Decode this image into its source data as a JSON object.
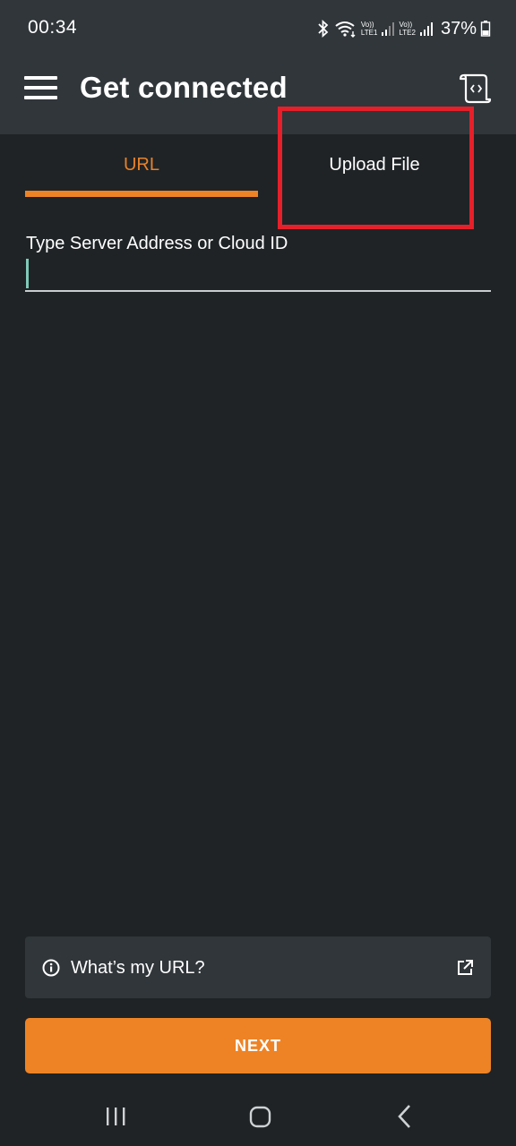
{
  "status_bar": {
    "time": "00:34",
    "sim1_label": "LTE1",
    "sim2_label": "LTE2",
    "volte_label": "Vo))",
    "battery": "37%"
  },
  "app_bar": {
    "title": "Get connected",
    "menu_icon": "hamburger-menu-icon",
    "right_icon": "code-document-icon"
  },
  "tabs": [
    {
      "label": "URL",
      "selected": true
    },
    {
      "label": "Upload File",
      "selected": false
    }
  ],
  "server_field": {
    "label": "Type Server Address or Cloud ID",
    "value": "",
    "placeholder": ""
  },
  "help": {
    "label": "What’s my URL?",
    "left_icon": "info-icon",
    "right_icon": "external-link-icon"
  },
  "next_button": {
    "label": "NEXT"
  },
  "colors": {
    "accent": "#ee8325",
    "header_bg": "#30363a",
    "screen_bg": "#1f2326",
    "highlight": "#e5202a"
  },
  "nav_bar": {
    "recent_icon": "recent-apps-icon",
    "home_icon": "home-icon",
    "back_icon": "back-icon"
  }
}
